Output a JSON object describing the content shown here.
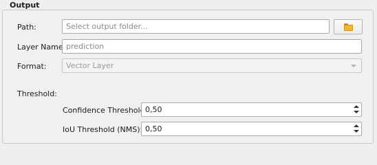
{
  "group": {
    "title": "Output"
  },
  "path": {
    "label": "Path:",
    "placeholder": "Select output folder...",
    "browse_icon": "folder-icon"
  },
  "layer_name": {
    "label": "Layer Name:",
    "placeholder": "prediction"
  },
  "format": {
    "label": "Format:",
    "value": "Vector Layer"
  },
  "threshold": {
    "label": "Threshold:",
    "confidence": {
      "label": "Confidence Threshold:",
      "value": "0,50"
    },
    "iou": {
      "label": "IoU Threshold (NMS):",
      "value": "0,50"
    }
  }
}
